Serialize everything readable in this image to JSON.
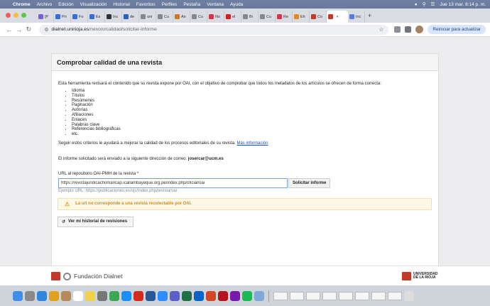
{
  "menubar": {
    "items": [
      "Chrome",
      "Archivo",
      "Edición",
      "Visualización",
      "Historial",
      "Favoritos",
      "Perfiles",
      "Pestaña",
      "Ventana",
      "Ayuda"
    ],
    "datetime": "Jue 13 mar.  8:14 p. m."
  },
  "tabs": [
    {
      "label": "[P",
      "color": "#7b61c9"
    },
    {
      "label": "Pri",
      "color": "#3a6cd1"
    },
    {
      "label": "Fo",
      "color": "#3a6cd1"
    },
    {
      "label": "Es",
      "color": "#3a6cd1"
    },
    {
      "label": "Inc",
      "color": "#333333"
    },
    {
      "label": "de",
      "color": "#2b5fb8"
    },
    {
      "label": "uni",
      "color": "#888888"
    },
    {
      "label": "Cu",
      "color": "#888888"
    },
    {
      "label": "An",
      "color": "#c57a2b"
    },
    {
      "label": "Cu",
      "color": "#888888"
    },
    {
      "label": "No",
      "color": "#d1364a"
    },
    {
      "label": "el",
      "color": "#cc2222"
    },
    {
      "label": "Bi",
      "color": "#888888"
    },
    {
      "label": "Cu",
      "color": "#888888"
    },
    {
      "label": "Re",
      "color": "#d1364a"
    },
    {
      "label": "Eh",
      "color": "#e08a2a"
    },
    {
      "label": "Co",
      "color": "#c0392b"
    }
  ],
  "active_tab": {
    "label": "",
    "color": "#c0392b"
  },
  "last_tab": {
    "label": "Inc",
    "color": "#5c7bd6"
  },
  "address": {
    "url_host": "dialnet.unirioja.es",
    "url_path": "/nexo/o/calidad/solicitar-informe",
    "update_button": "Reiniciar para actualizar"
  },
  "page": {
    "title": "Comprobar calidad de una revista",
    "intro": "Esta herramienta revisará el contenido que su revista expone por OAI, con el objetivo de comprobar que todos los metadatos de los artículos se ofrecen de forma correcta:",
    "criteria": [
      "Idioma",
      "Títulos",
      "Resúmenes",
      "Paginación",
      "Autorías",
      "Afiliaciones",
      "Enlaces",
      "Palabras clave",
      "Referencias bibliográficas",
      "etc."
    ],
    "hint_text": "Seguir estos criterios le ayudará a mejorar la calidad de los procesos editoriales de su revista.",
    "hint_link": "Más información",
    "email_text": "El informe solicitado será enviado a la siguiente dirección de correo:",
    "email": "josercar@ucm.es",
    "field_label": "URL al repositorio OAI-PMH de la revista  *",
    "field_value": "https://revistajuridicachomancap.icallambayeque.org.pe/index.php/oficial/oai",
    "submit_label": "Solicitar informe",
    "example": "Ejemplo URL: https://publicaciones.es/ojs/index.php/revista/oai",
    "alert": "La url no corresponde a una revista recolectable por OAI.",
    "history_button": "Ver mi historial de revisiones"
  },
  "footer": {
    "left": "Fundación Dialnet",
    "right_line1": "UNIVERSIDAD",
    "right_line2": "DE LA RIOJA"
  },
  "dock_apps": [
    {
      "name": "finder",
      "color": "#3d8fe8"
    },
    {
      "name": "launchpad",
      "color": "#8a8a8a"
    },
    {
      "name": "safari",
      "color": "#2e86de"
    },
    {
      "name": "photos",
      "color": "#e0a020"
    },
    {
      "name": "contacts",
      "color": "#b48a5a"
    },
    {
      "name": "calendar",
      "color": "#ffffff"
    },
    {
      "name": "notes",
      "color": "#f2d14a"
    },
    {
      "name": "system-settings",
      "color": "#777777"
    },
    {
      "name": "chrome",
      "color": "#3aa757"
    },
    {
      "name": "app-store",
      "color": "#1c8ef9"
    },
    {
      "name": "acrobat",
      "color": "#d52b1e"
    },
    {
      "name": "word",
      "color": "#2b5797"
    },
    {
      "name": "zoom",
      "color": "#2d8cff"
    },
    {
      "name": "teams",
      "color": "#5b5fc7"
    },
    {
      "name": "excel",
      "color": "#1e7145"
    },
    {
      "name": "outlook",
      "color": "#0a64c8"
    },
    {
      "name": "powerpoint",
      "color": "#d24726"
    },
    {
      "name": "mendeley",
      "color": "#b3141e"
    },
    {
      "name": "onenote",
      "color": "#7719aa"
    },
    {
      "name": "spotify",
      "color": "#1db954"
    },
    {
      "name": "preview",
      "color": "#7fa7d8"
    },
    {
      "name": "trash",
      "color": "#dddddd"
    }
  ]
}
